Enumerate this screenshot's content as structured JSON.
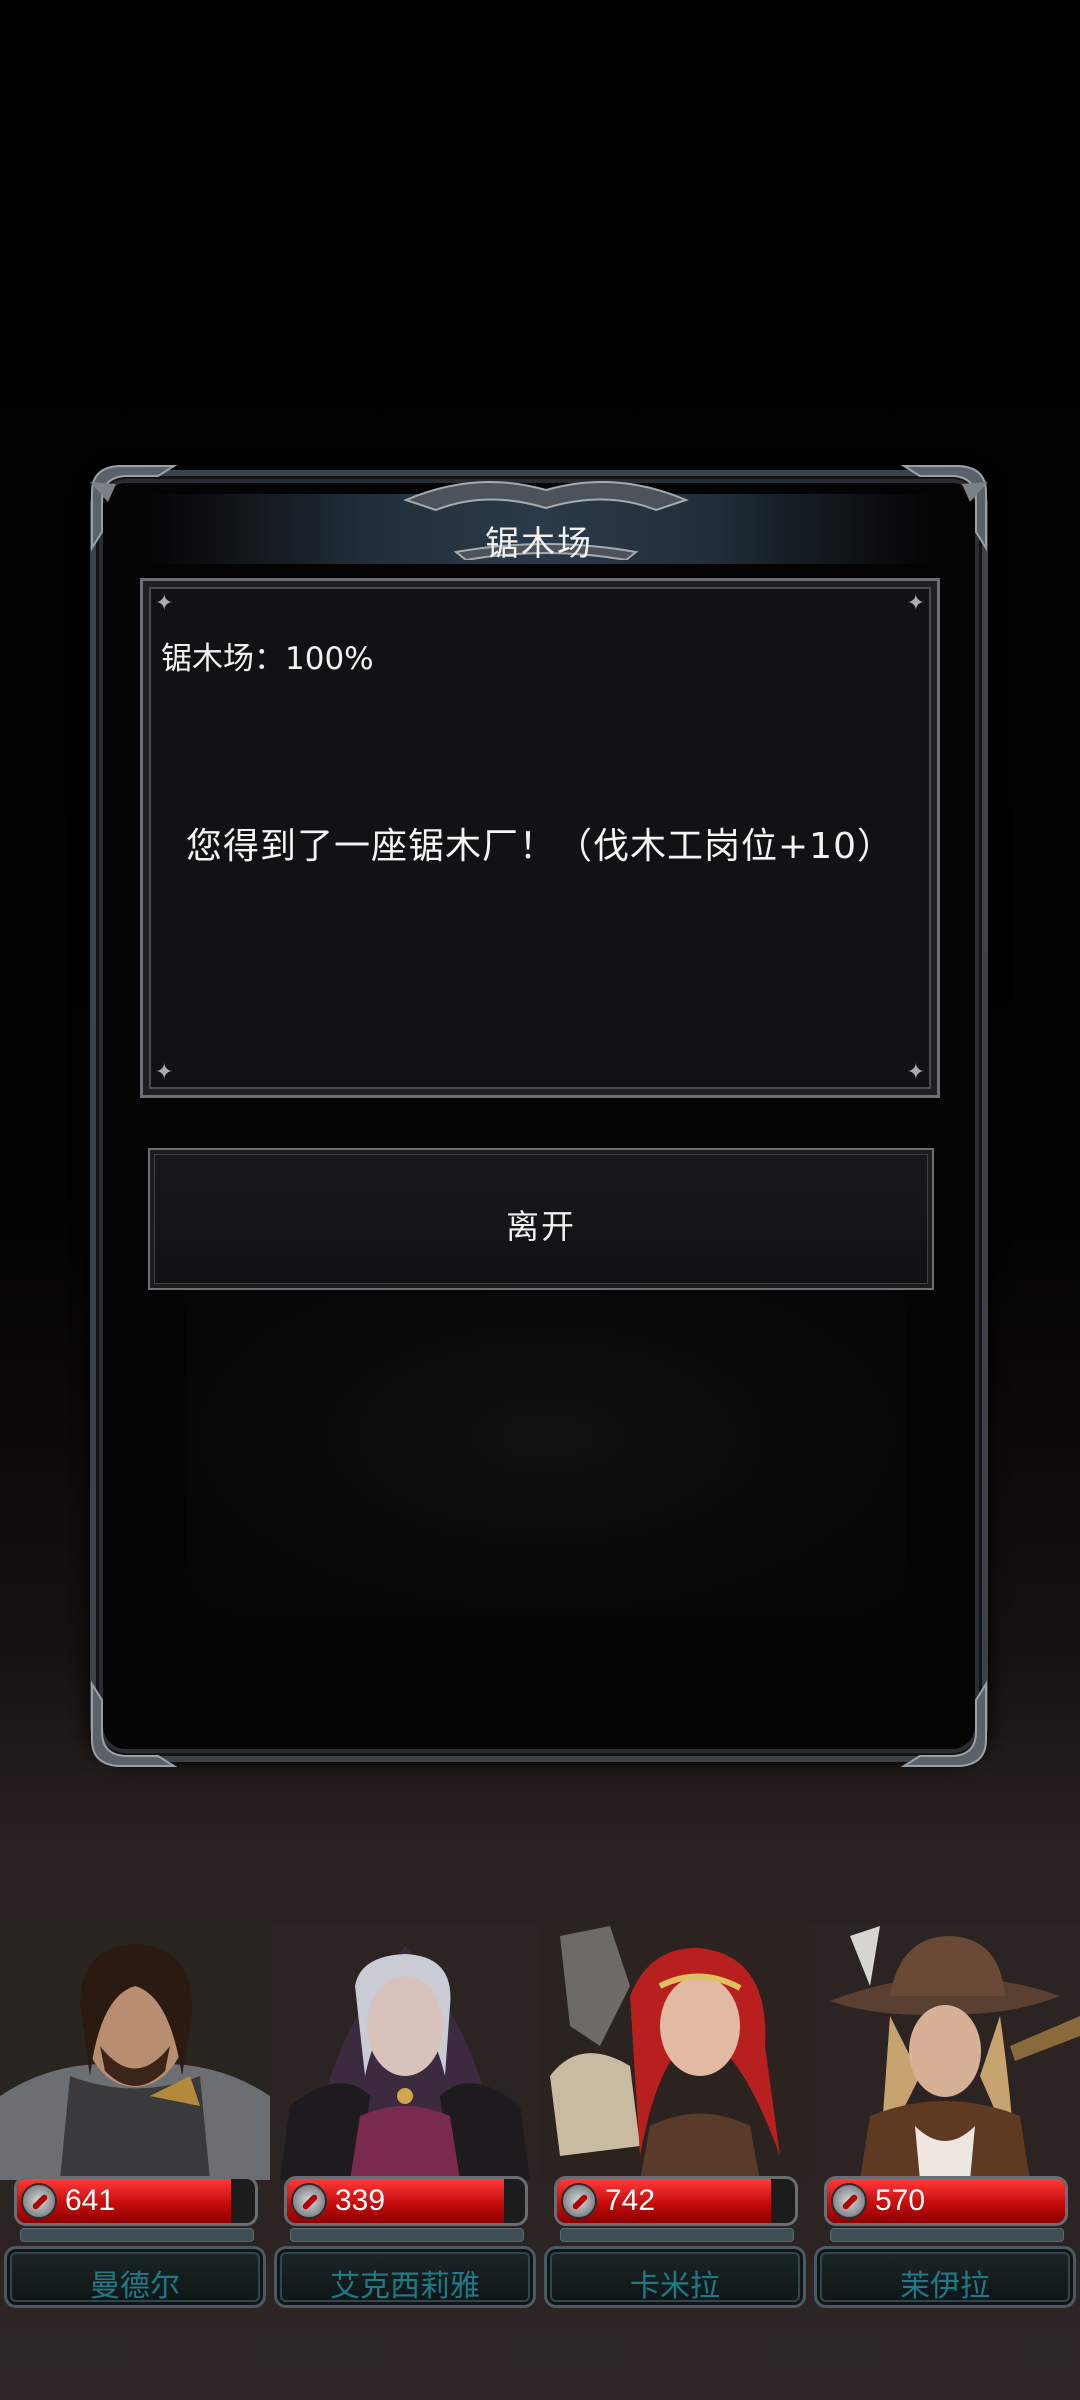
{
  "dialog": {
    "title": "锯木场",
    "progress_text": "锯木场：100%",
    "message": "您得到了一座锯木厂！（伐木工岗位+10）",
    "leave_button": "离开"
  },
  "heroes": [
    {
      "name": "曼德尔",
      "hp": "641",
      "hp_fill": 0.9
    },
    {
      "name": "艾克西莉雅",
      "hp": "339",
      "hp_fill": 0.91
    },
    {
      "name": "卡米拉",
      "hp": "742",
      "hp_fill": 0.9
    },
    {
      "name": "茉伊拉",
      "hp": "570",
      "hp_fill": 1.0
    }
  ],
  "colors": {
    "hp_bar": "#d11010",
    "name_text": "#1f7a84",
    "frame": "#3d4248"
  }
}
